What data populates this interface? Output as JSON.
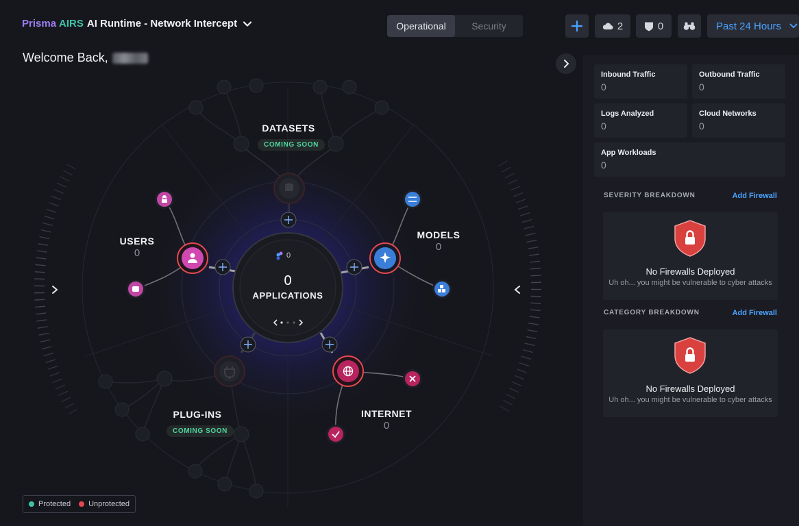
{
  "header": {
    "brand_prisma": "Prisma",
    "brand_airs": "AIRS",
    "title_rest": "AI Runtime - Network Intercept",
    "tabs": [
      {
        "label": "Operational",
        "active": true
      },
      {
        "label": "Security",
        "active": false
      }
    ],
    "cloud_count": "2",
    "shield_count": "0",
    "time_range": "Past 24 Hours"
  },
  "welcome": {
    "text": "Welcome Back,"
  },
  "graph": {
    "center": {
      "count": "0",
      "label": "APPLICATIONS",
      "sub_count": "0"
    },
    "nodes": {
      "datasets": {
        "label": "DATASETS",
        "badge": "COMING SOON"
      },
      "users": {
        "label": "USERS",
        "count": "0"
      },
      "models": {
        "label": "MODELS",
        "count": "0"
      },
      "plugins": {
        "label": "PLUG-INS",
        "badge": "COMING SOON"
      },
      "internet": {
        "label": "INTERNET",
        "count": "0"
      }
    },
    "legend": {
      "protected": "Protected",
      "unprotected": "Unprotected"
    }
  },
  "right_panel": {
    "stats": {
      "inbound": {
        "title": "Inbound Traffic",
        "value": "0"
      },
      "outbound": {
        "title": "Outbound Traffic",
        "value": "0"
      },
      "logs": {
        "title": "Logs Analyzed",
        "value": "0"
      },
      "cloud": {
        "title": "Cloud Networks",
        "value": "0"
      },
      "workloads": {
        "title": "App Workloads",
        "value": "0"
      }
    },
    "severity": {
      "title": "SEVERITY BREAKDOWN",
      "link": "Add Firewall",
      "empty_title": "No Firewalls Deployed",
      "empty_text": "Uh oh... you might be vulnerable to cyber attacks"
    },
    "category": {
      "title": "CATEGORY BREAKDOWN",
      "link": "Add Firewall",
      "empty_title": "No Firewalls Deployed",
      "empty_text": "Uh oh... you might be vulnerable to cyber attacks"
    }
  },
  "colors": {
    "accent": "#4aa3ff",
    "protected": "#3ec3a8",
    "unprotected": "#e5484d",
    "users_node": "#d048b0",
    "models_node": "#3a7ed8",
    "internet_node": "#b8245e"
  }
}
